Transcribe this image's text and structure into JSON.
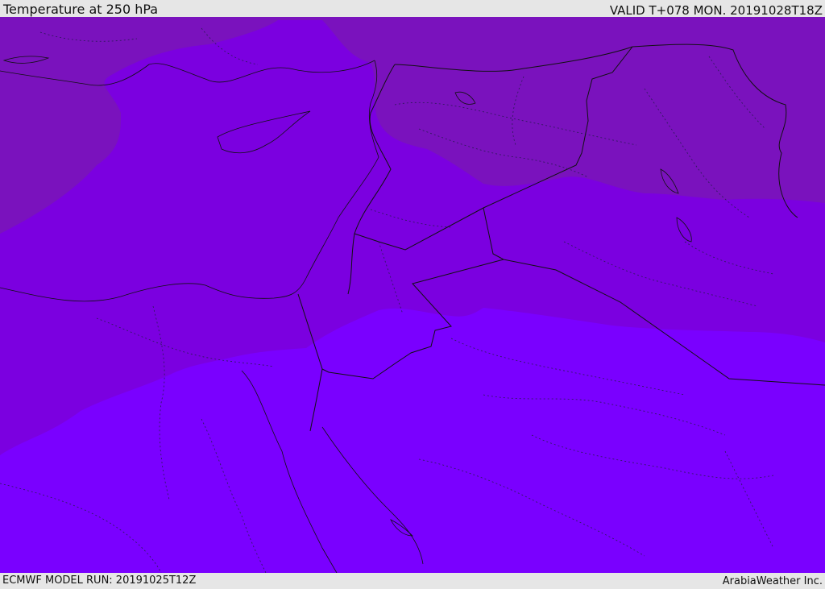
{
  "header": {
    "title": "Temperature at 250 hPa",
    "valid": "VALID T+078 MON. 20191028T18Z"
  },
  "footer": {
    "run": "ECMWF MODEL RUN: 20191025T12Z",
    "credit": "ArabiaWeather Inc."
  },
  "colors": {
    "band_dark": "#7a12bd",
    "band_mid": "#7b00e0",
    "band_light": "#7a00ff",
    "border": "#111111"
  }
}
